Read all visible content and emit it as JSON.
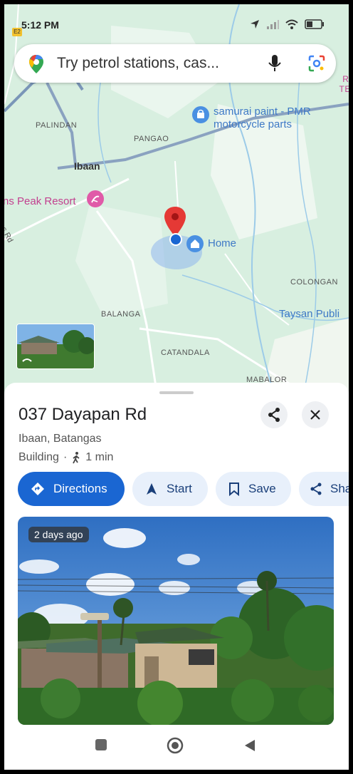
{
  "status_bar": {
    "time": "5:12 PM",
    "notif": "E2"
  },
  "search": {
    "placeholder": "Try petrol stations, cas..."
  },
  "map": {
    "labels": {
      "palindan": "PALINDAN",
      "pangao": "PANGAO",
      "ibaan": "Ibaan",
      "balanga": "BALANGA",
      "catandala": "CATANDALA",
      "colongan": "COLONGAN",
      "mabalor": "MABALOR",
      "road": "gas Rd",
      "edge_rt": "RT",
      "edge_tel": "TEL"
    },
    "poi_store": "samurai paint - PMR\nmotorcycle parts",
    "poi_resort": "ns Peak Resort",
    "poi_home": "Home",
    "poi_school": "Taysan Publi"
  },
  "place": {
    "title": "037 Dayapan Rd",
    "address": "Ibaan, Batangas",
    "type": "Building",
    "walk_time": "1 min"
  },
  "actions": {
    "directions": "Directions",
    "start": "Start",
    "save": "Save",
    "share": "Sha"
  },
  "photo": {
    "age_badge": "2 days ago"
  },
  "colors": {
    "accent": "#1a66d2",
    "pin": "#e53935",
    "map_bg": "#d8efe0"
  }
}
